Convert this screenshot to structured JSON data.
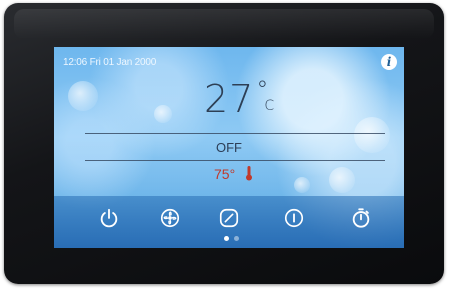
{
  "header": {
    "datetime": "12:06 Fri 01 Jan 2000",
    "info_label": "i"
  },
  "temperature": {
    "value": "27",
    "degree_symbol": "°",
    "unit": "C"
  },
  "status": "OFF",
  "setpoint": {
    "value": "75°",
    "icon": "thermometer-icon"
  },
  "toolbar": {
    "icons": [
      "power-icon",
      "fan-icon",
      "mode-icon",
      "info-icon",
      "timer-icon"
    ]
  },
  "pager": {
    "page_count": 2,
    "active_page": 1
  },
  "colors": {
    "temperature_text": "#2d3f55",
    "setpoint_text": "#c0392b",
    "toolbar_icon": "#ffffff",
    "screen_bg": "#7fc0ef"
  }
}
